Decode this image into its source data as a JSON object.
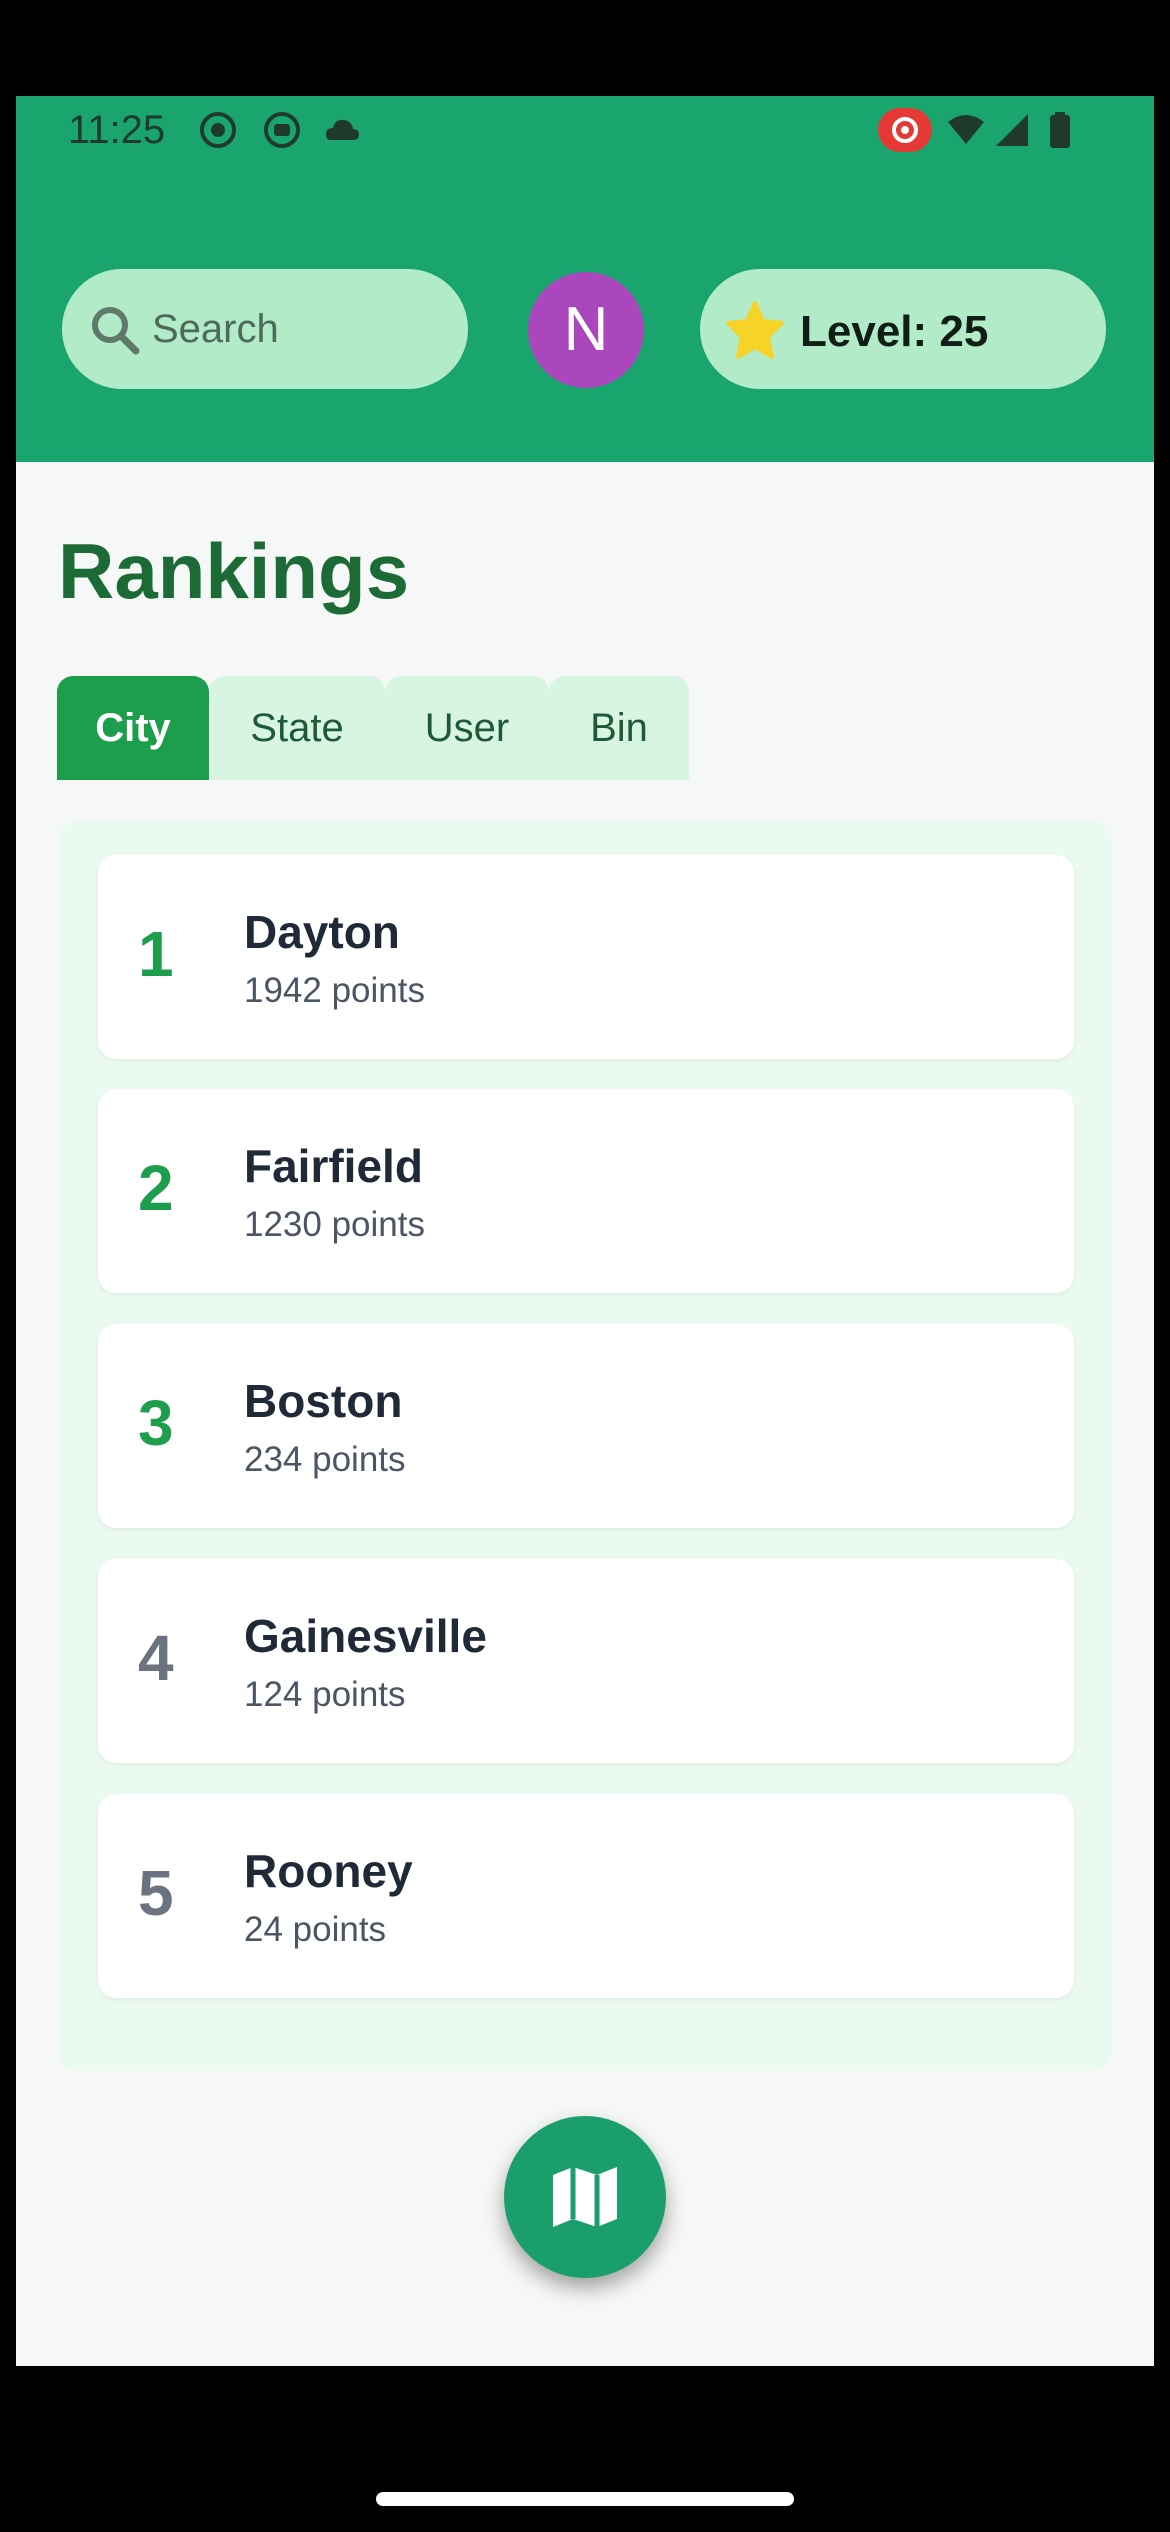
{
  "status_bar": {
    "time": "11:25"
  },
  "header": {
    "search": {
      "placeholder": "Search"
    },
    "avatar_initial": "N",
    "level": {
      "text": "Level: 25"
    }
  },
  "page": {
    "title": "Rankings"
  },
  "tabs": [
    {
      "label": "City",
      "active": true
    },
    {
      "label": "State",
      "active": false
    },
    {
      "label": "User",
      "active": false
    },
    {
      "label": "Bin",
      "active": false
    }
  ],
  "rankings": [
    {
      "rank": "1",
      "name": "Dayton",
      "points": "1942 points"
    },
    {
      "rank": "2",
      "name": "Fairfield",
      "points": "1230 points"
    },
    {
      "rank": "3",
      "name": "Boston",
      "points": "234 points"
    },
    {
      "rank": "4",
      "name": "Gainesville",
      "points": "124 points"
    },
    {
      "rank": "5",
      "name": "Rooney",
      "points": "24 points"
    }
  ],
  "colors": {
    "header_green": "#1aa56f",
    "pill_green": "#b2ebc8",
    "accent_green": "#1d9e4c",
    "title_green": "#1c6b36",
    "avatar_purple": "#ab47bc",
    "star_yellow": "#f5d327"
  },
  "icons": {
    "search": "search-icon",
    "level": "star-icon",
    "fab": "map-icon"
  }
}
